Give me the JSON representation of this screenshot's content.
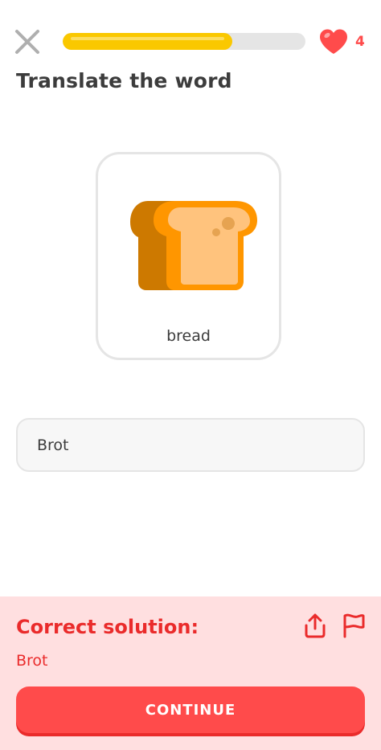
{
  "header": {
    "close_icon": "close-icon",
    "progress": 0.7,
    "hearts_icon": "heart-icon",
    "hearts_count": "4"
  },
  "prompt": {
    "title": "Translate the word"
  },
  "word_card": {
    "illustration": "bread-slice",
    "word": "bread"
  },
  "answer": {
    "value": "Brot"
  },
  "feedback": {
    "title": "Correct solution:",
    "solution": "Brot",
    "share_icon": "share-icon",
    "report_icon": "flag-icon",
    "continue_label": "CONTINUE"
  },
  "colors": {
    "progress_fill": "#fac800",
    "progress_track": "#e5e5e5",
    "heart": "#ff4b4b",
    "feedback_background": "#ffdfe0",
    "feedback_text": "#ea2b2b",
    "button": "#ff4b4b",
    "button_shadow": "#ea2b2b"
  }
}
